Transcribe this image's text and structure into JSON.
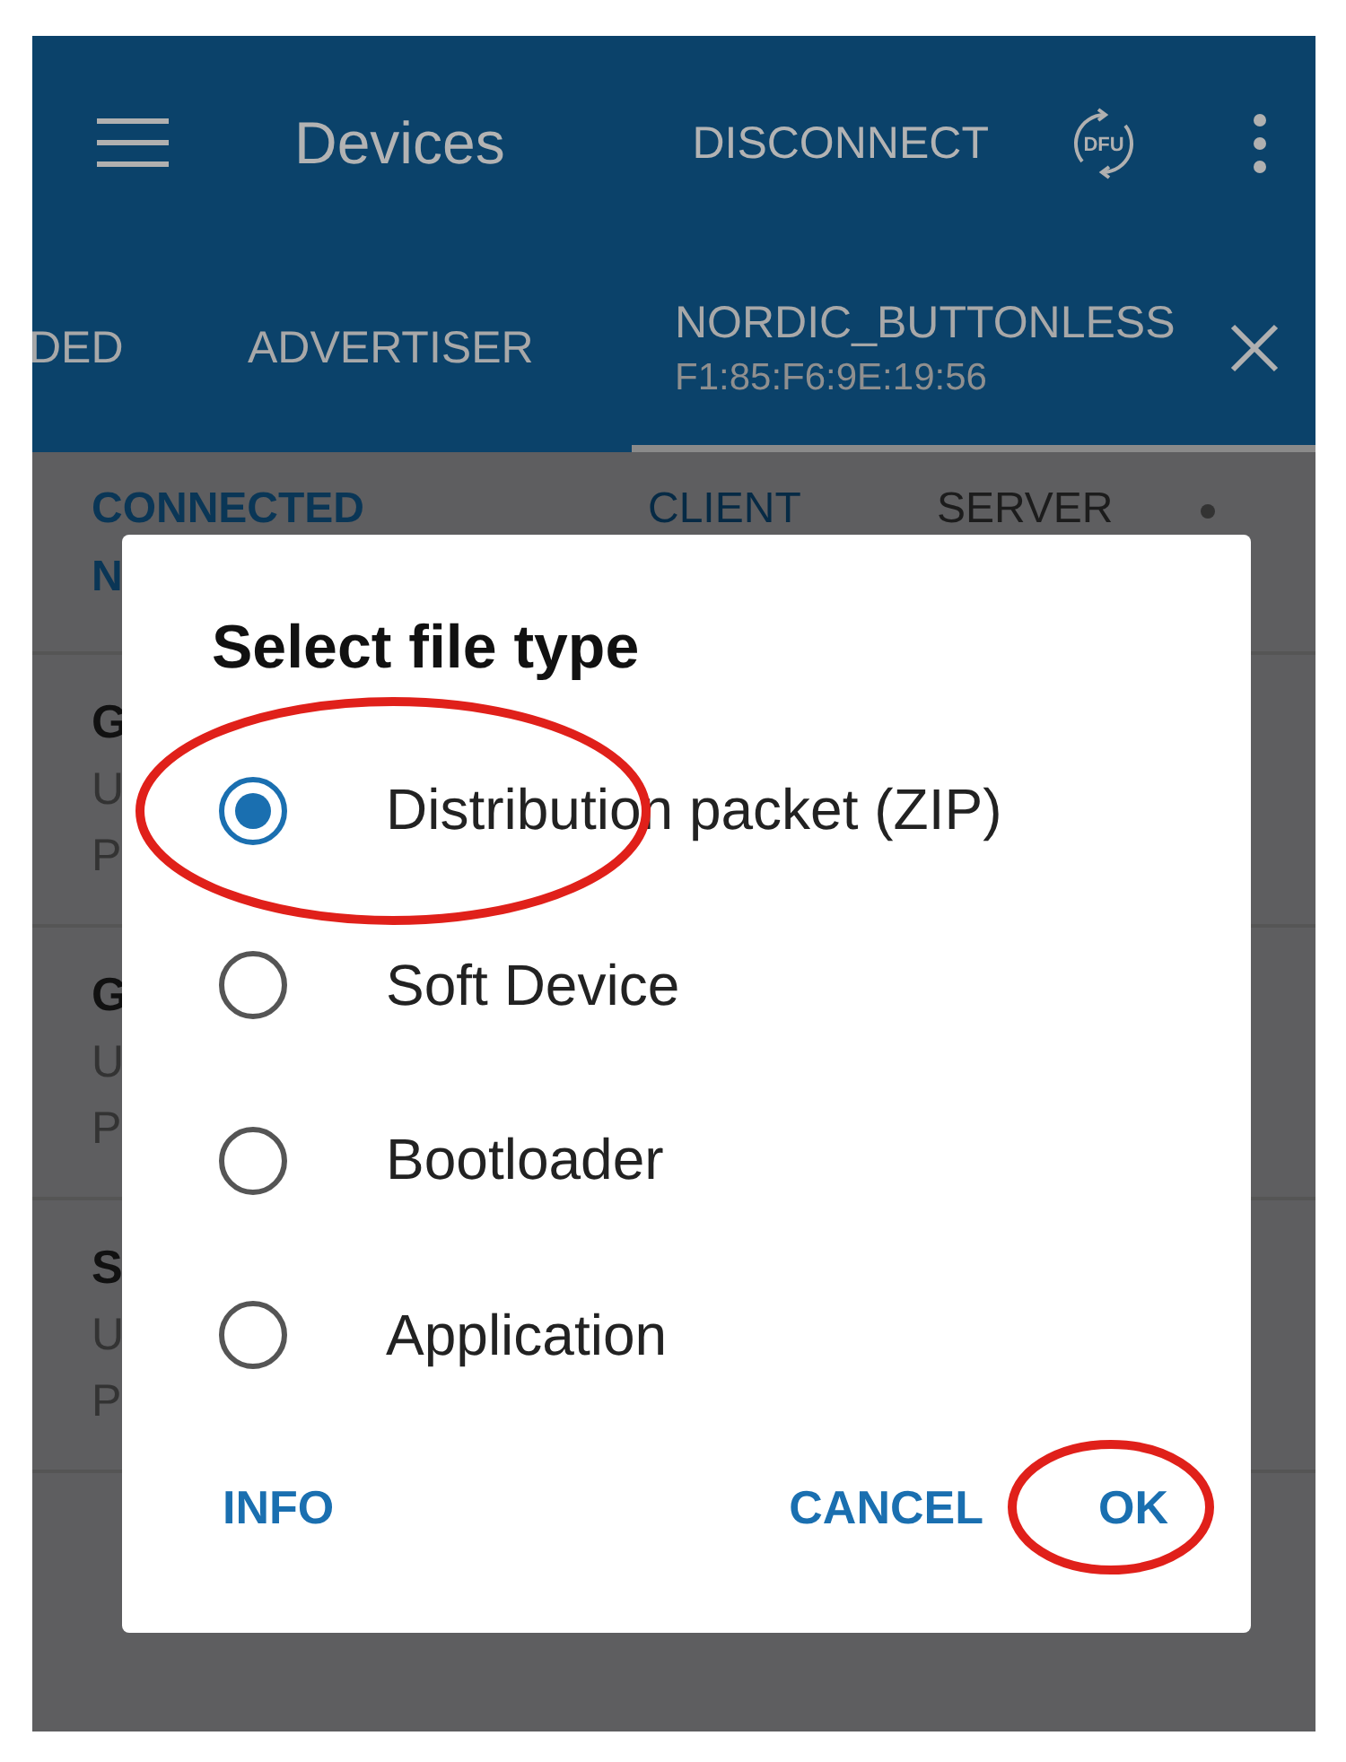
{
  "app_bar": {
    "title": "Devices",
    "action": "DISCONNECT",
    "dfu_label": "DFU"
  },
  "tabs": [
    {
      "label": "DED",
      "selected": false
    },
    {
      "label": "ADVERTISER",
      "selected": false
    },
    {
      "label": "NORDIC_BUTTONLESS",
      "subtitle": "F1:85:F6:9E:19:56",
      "selected": true
    }
  ],
  "sub_header": {
    "status": "CONNECTED",
    "status_line_2": "N",
    "tabs": [
      {
        "label": "CLIENT",
        "selected": true
      },
      {
        "label": "SERVER",
        "selected": false
      }
    ]
  },
  "services": [
    {
      "name": "G",
      "line_1": "U",
      "line_2": "P"
    },
    {
      "name": "G",
      "line_1": "U",
      "line_2": "P"
    },
    {
      "name": "S",
      "line_1": "U",
      "line_2": "P"
    }
  ],
  "dialog": {
    "title": "Select file type",
    "options": [
      {
        "label": "Distribution packet (ZIP)",
        "selected": true,
        "circled": true
      },
      {
        "label": "Soft Device",
        "selected": false,
        "circled": false
      },
      {
        "label": "Bootloader",
        "selected": false,
        "circled": false
      },
      {
        "label": "Application",
        "selected": false,
        "circled": false
      }
    ],
    "buttons": [
      {
        "label": "INFO",
        "circled": false
      },
      {
        "label": "CANCEL",
        "circled": false
      },
      {
        "label": "OK",
        "circled": true
      }
    ]
  }
}
